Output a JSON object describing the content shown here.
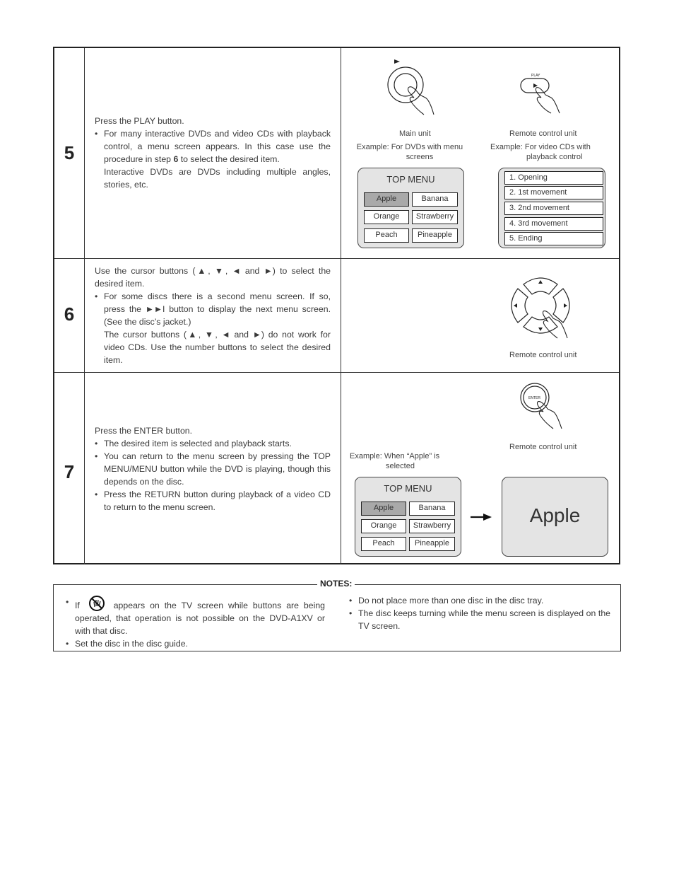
{
  "steps": [
    {
      "number": "5",
      "intro": "Press the PLAY button.",
      "bullet_1": {
        "pre": "For many interactive DVDs and video CDs with playback control, a menu screen appears. In this case use the procedure in step ",
        "bold": "6",
        "post": " to select the desired item."
      },
      "bullet_1_cont": "Interactive DVDs are DVDs including multiple angles, stories, etc.",
      "fig_main_symbol": "►",
      "fig_main_caption": "Main unit",
      "fig_remote_label": "PLAY",
      "fig_remote_symbol": "►",
      "fig_remote_caption": "Remote control unit",
      "example_dvd": "Example: For DVDs with menu screens",
      "example_dvd_l1": "Example: For DVDs with menu",
      "example_dvd_l2": "screens",
      "example_vcd_l1": "Example: For video CDs with",
      "example_vcd_l2": "playback control",
      "top_menu": {
        "title": "TOP MENU",
        "items": [
          "Apple",
          "Banana",
          "Orange",
          "Strawberry",
          "Peach",
          "Pineapple"
        ],
        "selected": "Apple"
      },
      "vcd_menu": [
        "1. Opening",
        "2. 1st movement",
        "3. 2nd movement",
        "4. 3rd movement",
        "5. Ending"
      ]
    },
    {
      "number": "6",
      "intro": "Use the cursor buttons (▲, ▼, ◄ and ►) to select the desired item.",
      "bullet_1": "For some discs there is a second menu screen. If so, press the ►►I button to display the next menu screen. (See the disc’s jacket.)",
      "bullet_1_cont": "The cursor buttons (▲, ▼, ◄ and ►) do not work for video CDs. Use the number buttons to select the desired item.",
      "fig_caption": "Remote control unit",
      "cursor_symbols": {
        "up": "▲",
        "down": "▼",
        "left": "◄",
        "right": "►"
      }
    },
    {
      "number": "7",
      "intro": "Press the ENTER button.",
      "bullets": [
        "The desired item is selected and playback starts.",
        "You can return to the menu screen by pressing the TOP MENU/MENU button while the DVD is playing, though this depends on the disc.",
        "Press the RETURN button during playback of a video CD to return to the menu screen."
      ],
      "fig_label": "ENTER",
      "fig_caption": "Remote control unit",
      "example_l1": "Example: When “Apple” is",
      "example_l2": "selected",
      "top_menu": {
        "title": "TOP MENU",
        "items": [
          "Apple",
          "Banana",
          "Orange",
          "Strawberry",
          "Peach",
          "Pineapple"
        ],
        "selected": "Apple"
      },
      "result_screen": "Apple"
    }
  ],
  "notes": {
    "title": "NOTES:",
    "left": [
      {
        "pre": "If",
        "post": "appears on the TV screen while buttons are being operated, that operation is not possible on the DVD-A1XV or with that disc."
      },
      {
        "text": "Set the disc in the disc guide."
      }
    ],
    "right": [
      "Do not place more than one disc in the disc tray.",
      "The disc keeps turning while the menu screen is displayed on the TV screen."
    ]
  }
}
